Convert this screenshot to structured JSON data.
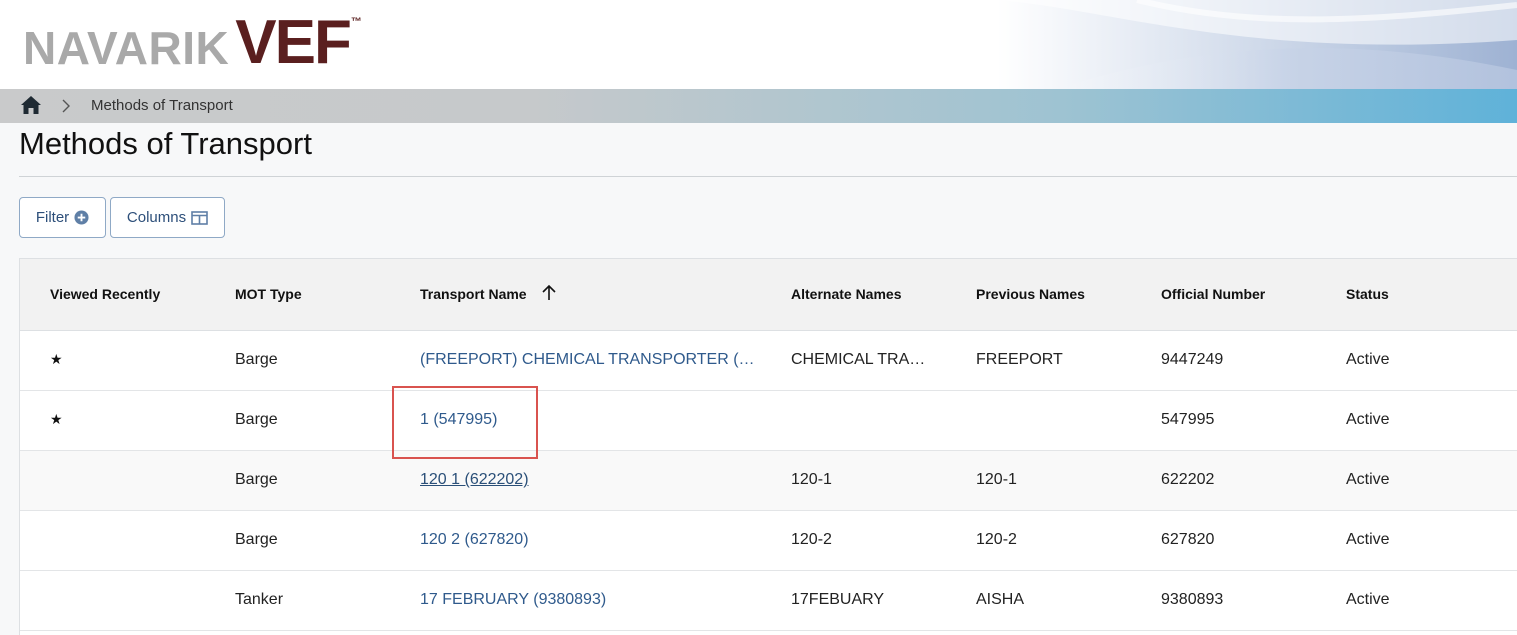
{
  "header": {
    "logo_navarik": "NAVARIK",
    "logo_vef": "VEF",
    "logo_tm": "™"
  },
  "breadcrumb": {
    "current": "Methods of Transport"
  },
  "page": {
    "title": "Methods of Transport"
  },
  "toolbar": {
    "filter_label": "Filter",
    "columns_label": "Columns"
  },
  "table": {
    "columns": [
      "Viewed Recently",
      "MOT Type",
      "Transport Name",
      "Alternate Names",
      "Previous Names",
      "Official Number",
      "Status"
    ],
    "sorted_column": "Transport Name",
    "sort_direction": "ascending",
    "rows": [
      {
        "viewed": "★",
        "mot_type": "Barge",
        "transport_name": "(FREEPORT) CHEMICAL TRANSPORTER (…",
        "alternate_names": "CHEMICAL TRA…",
        "previous_names": "FREEPORT",
        "official_number": "9447249",
        "status": "Active"
      },
      {
        "viewed": "★",
        "mot_type": "Barge",
        "transport_name": "1 (547995)",
        "alternate_names": "",
        "previous_names": "",
        "official_number": "547995",
        "status": "Active"
      },
      {
        "viewed": "",
        "mot_type": "Barge",
        "transport_name": "120 1 (622202)",
        "alternate_names": "120-1",
        "previous_names": "120-1",
        "official_number": "622202",
        "status": "Active"
      },
      {
        "viewed": "",
        "mot_type": "Barge",
        "transport_name": "120 2 (627820)",
        "alternate_names": "120-2",
        "previous_names": "120-2",
        "official_number": "627820",
        "status": "Active"
      },
      {
        "viewed": "",
        "mot_type": "Tanker",
        "transport_name": "17 FEBRUARY (9380893)",
        "alternate_names": "17FEBUARY",
        "previous_names": "AISHA",
        "official_number": "9380893",
        "status": "Active"
      }
    ]
  },
  "colors": {
    "link": "#2f5a8c",
    "button_border": "#8fa9c6",
    "logo_gray": "#a9a9a9",
    "logo_maroon": "#5a1f1f",
    "highlight": "#d9534f"
  }
}
